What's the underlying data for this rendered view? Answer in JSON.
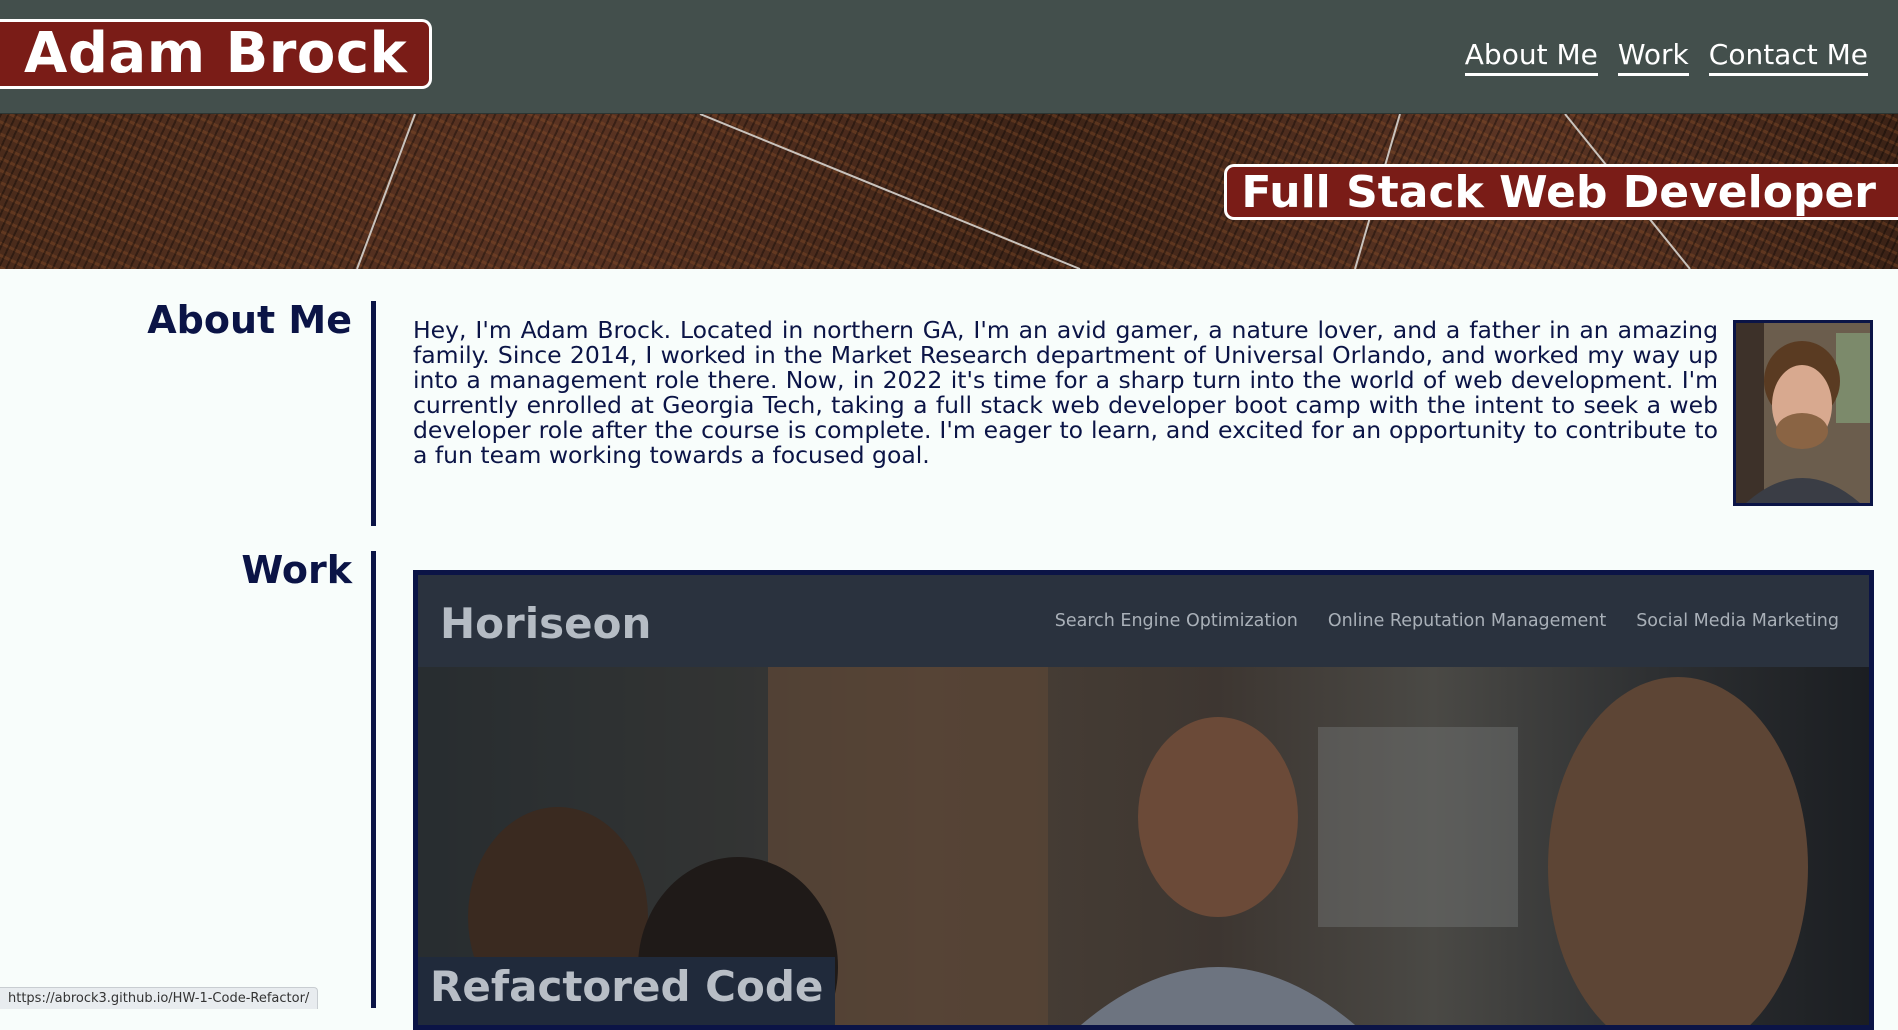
{
  "header": {
    "name": "Adam Brock",
    "nav": [
      "About Me",
      "Work",
      "Contact Me"
    ]
  },
  "hero": {
    "tagline": "Full Stack Web Developer"
  },
  "about": {
    "title": "About Me",
    "text": "Hey, I'm Adam Brock. Located in northern GA, I'm an avid gamer, a nature lover, and a father in an amazing family. Since 2014, I worked in the Market Research department of Universal Orlando, and worked my way up into a management role there. Now, in 2022 it's time for a sharp turn into the world of web development. I'm currently enrolled at Georgia Tech, taking a full stack web developer boot camp with the intent to seek a web developer role after the course is complete. I'm eager to learn, and excited for an opportunity to contribute to a fun team working towards a focused goal."
  },
  "work": {
    "title": "Work",
    "project": {
      "site_brand": "Horiseon",
      "site_links": [
        "Search Engine Optimization",
        "Online Reputation Management",
        "Social Media Marketing"
      ],
      "label": "Refactored Code"
    }
  },
  "status_bar": {
    "url": "https://abrock3.github.io/HW-1-Code-Refactor/"
  },
  "colors": {
    "header_bg": "#434f4c",
    "accent_red": "#7a1c17",
    "navy": "#0b1446",
    "page_bg": "#f8fdfb"
  }
}
